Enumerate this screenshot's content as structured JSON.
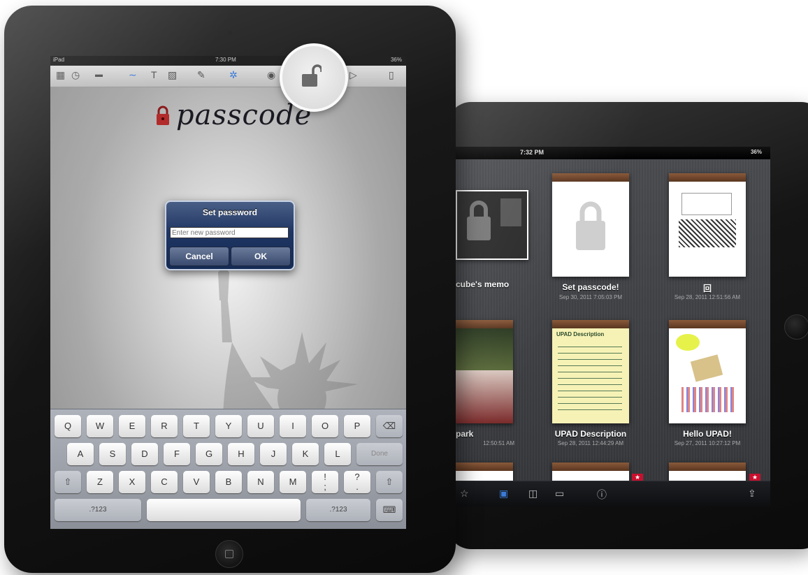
{
  "front_ipad": {
    "status": {
      "carrier": "iPad",
      "time": "7:30 PM",
      "battery": "36%"
    },
    "logo_text": "passcode",
    "dialog": {
      "title": "Set password",
      "input_placeholder": "Enter new password",
      "cancel_label": "Cancel",
      "ok_label": "OK"
    },
    "keyboard": {
      "row1": [
        "Q",
        "W",
        "E",
        "R",
        "T",
        "Y",
        "U",
        "I",
        "O",
        "P"
      ],
      "row2": [
        "A",
        "S",
        "D",
        "F",
        "G",
        "H",
        "J",
        "K",
        "L"
      ],
      "row3": [
        "Z",
        "X",
        "C",
        "V",
        "B",
        "N",
        "M",
        "!",
        ";",
        "?",
        "."
      ],
      "done_label": "Done",
      "numbers_label": ".?123"
    }
  },
  "back_ipad": {
    "status": {
      "time": "7:32 PM",
      "battery": "36%"
    },
    "memos": [
      {
        "title": "cube's memo",
        "date": ""
      },
      {
        "title": "Set passcode!",
        "date": "Sep 30, 2011 7:05:03 PM"
      },
      {
        "title": "回",
        "date": "Sep 28, 2011 12:51:56 AM"
      },
      {
        "title": "park",
        "date": "12:50:51 AM"
      },
      {
        "title": "UPAD Description",
        "date": "Sep 28, 2011 12:44:29 AM"
      },
      {
        "title": "Hello UPAD!",
        "date": "Sep 27, 2011 10:27:12 PM"
      }
    ],
    "upad_heading": "UPAD Description"
  },
  "colors": {
    "dialog_blue": "#1f3563",
    "bezel": "#111111",
    "accent_blue": "#3b7bd8"
  }
}
